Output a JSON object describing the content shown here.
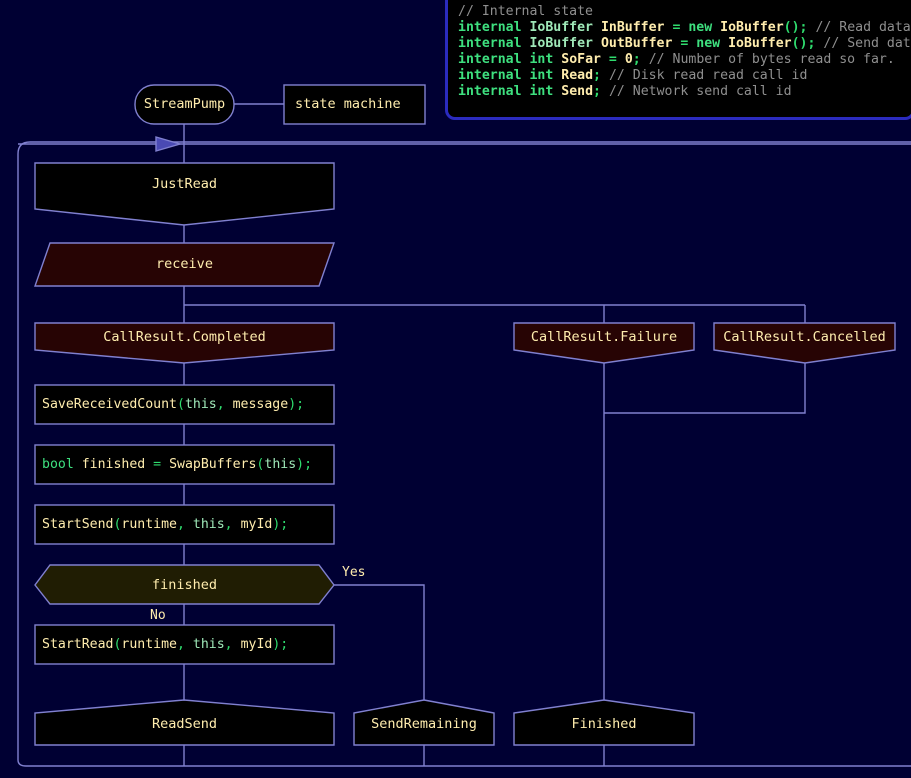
{
  "theme": {
    "background": "#000033",
    "line": "#8080d0",
    "node_fill_black": "#000000",
    "node_fill_red": "#270404",
    "node_fill_olive": "#201d03",
    "node_text": "#ffedae",
    "code_border": "#2b2bbf",
    "comment": "#8f8f8f",
    "keyword": "#3ee07f",
    "type": "#9fe8b8",
    "punct": "#2fdc6e"
  },
  "code_block": {
    "name": "internal-state-code",
    "lines": [
      {
        "tokens": [
          {
            "t": "// Internal state",
            "c": "c-com"
          }
        ]
      },
      {
        "tokens": [
          {
            "t": "internal",
            "c": "c-kw"
          },
          {
            "t": " ",
            "c": "c-id"
          },
          {
            "t": "IoBuffer",
            "c": "c-type"
          },
          {
            "t": " ",
            "c": "c-id"
          },
          {
            "t": "InBuffer",
            "c": "c-id"
          },
          {
            "t": " ",
            "c": "c-id"
          },
          {
            "t": "=",
            "c": "c-op"
          },
          {
            "t": " ",
            "c": "c-id"
          },
          {
            "t": "new",
            "c": "c-kw"
          },
          {
            "t": " ",
            "c": "c-id"
          },
          {
            "t": "IoBuffer",
            "c": "c-id"
          },
          {
            "t": "();",
            "c": "c-op"
          },
          {
            "t": " ",
            "c": "c-id"
          },
          {
            "t": "// Read data",
            "c": "c-com"
          }
        ]
      },
      {
        "tokens": [
          {
            "t": "internal",
            "c": "c-kw"
          },
          {
            "t": " ",
            "c": "c-id"
          },
          {
            "t": "IoBuffer",
            "c": "c-type"
          },
          {
            "t": " ",
            "c": "c-id"
          },
          {
            "t": "OutBuffer",
            "c": "c-id"
          },
          {
            "t": " ",
            "c": "c-id"
          },
          {
            "t": "=",
            "c": "c-op"
          },
          {
            "t": " ",
            "c": "c-id"
          },
          {
            "t": "new",
            "c": "c-kw"
          },
          {
            "t": " ",
            "c": "c-id"
          },
          {
            "t": "IoBuffer",
            "c": "c-id"
          },
          {
            "t": "();",
            "c": "c-op"
          },
          {
            "t": " ",
            "c": "c-id"
          },
          {
            "t": "// Send dat",
            "c": "c-com"
          }
        ]
      },
      {
        "tokens": [
          {
            "t": "internal",
            "c": "c-kw"
          },
          {
            "t": " ",
            "c": "c-id"
          },
          {
            "t": "int",
            "c": "c-kw"
          },
          {
            "t": " ",
            "c": "c-id"
          },
          {
            "t": "SoFar",
            "c": "c-id"
          },
          {
            "t": " ",
            "c": "c-id"
          },
          {
            "t": "=",
            "c": "c-op"
          },
          {
            "t": " ",
            "c": "c-id"
          },
          {
            "t": "0",
            "c": "c-num"
          },
          {
            "t": ";",
            "c": "c-op"
          },
          {
            "t": " ",
            "c": "c-id"
          },
          {
            "t": "// Number of bytes read so far.",
            "c": "c-com"
          }
        ]
      },
      {
        "tokens": [
          {
            "t": "internal",
            "c": "c-kw"
          },
          {
            "t": " ",
            "c": "c-id"
          },
          {
            "t": "int",
            "c": "c-kw"
          },
          {
            "t": " ",
            "c": "c-id"
          },
          {
            "t": "Read",
            "c": "c-id"
          },
          {
            "t": ";",
            "c": "c-op"
          },
          {
            "t": " ",
            "c": "c-id"
          },
          {
            "t": "// Disk read read call id",
            "c": "c-com"
          }
        ]
      },
      {
        "tokens": [
          {
            "t": "internal",
            "c": "c-kw"
          },
          {
            "t": " ",
            "c": "c-id"
          },
          {
            "t": "int",
            "c": "c-kw"
          },
          {
            "t": " ",
            "c": "c-id"
          },
          {
            "t": "Send",
            "c": "c-id"
          },
          {
            "t": ";",
            "c": "c-op"
          },
          {
            "t": " ",
            "c": "c-id"
          },
          {
            "t": "// Network send call id",
            "c": "c-com"
          }
        ]
      }
    ]
  },
  "nodes": {
    "stream_pump": {
      "label": "StreamPump",
      "shape": "rounded-rect"
    },
    "state_machine": {
      "label": "state machine",
      "shape": "rect"
    },
    "just_read": {
      "label": "JustRead",
      "shape": "pentagon-down"
    },
    "receive": {
      "label": "receive",
      "shape": "parallelogram"
    },
    "call_result_completed": {
      "label": "CallResult.Completed",
      "shape": "pentagon-down"
    },
    "call_result_failure": {
      "label": "CallResult.Failure",
      "shape": "pentagon-down"
    },
    "call_result_cancelled": {
      "label": "CallResult.Cancelled",
      "shape": "pentagon-down"
    },
    "finished_decision": {
      "label": "finished",
      "shape": "hexagon"
    },
    "read_send": {
      "label": "ReadSend",
      "shape": "pentagon-up"
    },
    "send_remaining": {
      "label": "SendRemaining",
      "shape": "pentagon-up"
    },
    "finished_state": {
      "label": "Finished",
      "shape": "pentagon-up"
    }
  },
  "code_nodes": [
    {
      "name": "save-received-count",
      "tokens": [
        {
          "t": "SaveReceivedCount",
          "c": "c-fn"
        },
        {
          "t": "(",
          "c": "c-op"
        },
        {
          "t": "this",
          "c": "c-type"
        },
        {
          "t": ",",
          "c": "c-op"
        },
        {
          "t": " message",
          "c": "c-id"
        },
        {
          "t": ");",
          "c": "c-op"
        }
      ]
    },
    {
      "name": "swap-buffers",
      "tokens": [
        {
          "t": "bool",
          "c": "c-kw"
        },
        {
          "t": " finished ",
          "c": "c-id"
        },
        {
          "t": "=",
          "c": "c-op"
        },
        {
          "t": " ",
          "c": "c-id"
        },
        {
          "t": "SwapBuffers",
          "c": "c-fn"
        },
        {
          "t": "(",
          "c": "c-op"
        },
        {
          "t": "this",
          "c": "c-type"
        },
        {
          "t": ");",
          "c": "c-op"
        }
      ]
    },
    {
      "name": "start-send",
      "tokens": [
        {
          "t": "StartSend",
          "c": "c-fn"
        },
        {
          "t": "(",
          "c": "c-op"
        },
        {
          "t": "runtime",
          "c": "c-id"
        },
        {
          "t": ",",
          "c": "c-op"
        },
        {
          "t": " ",
          "c": "c-id"
        },
        {
          "t": "this",
          "c": "c-type"
        },
        {
          "t": ",",
          "c": "c-op"
        },
        {
          "t": " myId",
          "c": "c-id"
        },
        {
          "t": ");",
          "c": "c-op"
        }
      ]
    },
    {
      "name": "start-read",
      "tokens": [
        {
          "t": "StartRead",
          "c": "c-fn"
        },
        {
          "t": "(",
          "c": "c-op"
        },
        {
          "t": "runtime",
          "c": "c-id"
        },
        {
          "t": ",",
          "c": "c-op"
        },
        {
          "t": " ",
          "c": "c-id"
        },
        {
          "t": "this",
          "c": "c-type"
        },
        {
          "t": ",",
          "c": "c-op"
        },
        {
          "t": " myId",
          "c": "c-id"
        },
        {
          "t": ");",
          "c": "c-op"
        }
      ]
    }
  ],
  "edge_labels": {
    "yes": "Yes",
    "no": "No"
  }
}
